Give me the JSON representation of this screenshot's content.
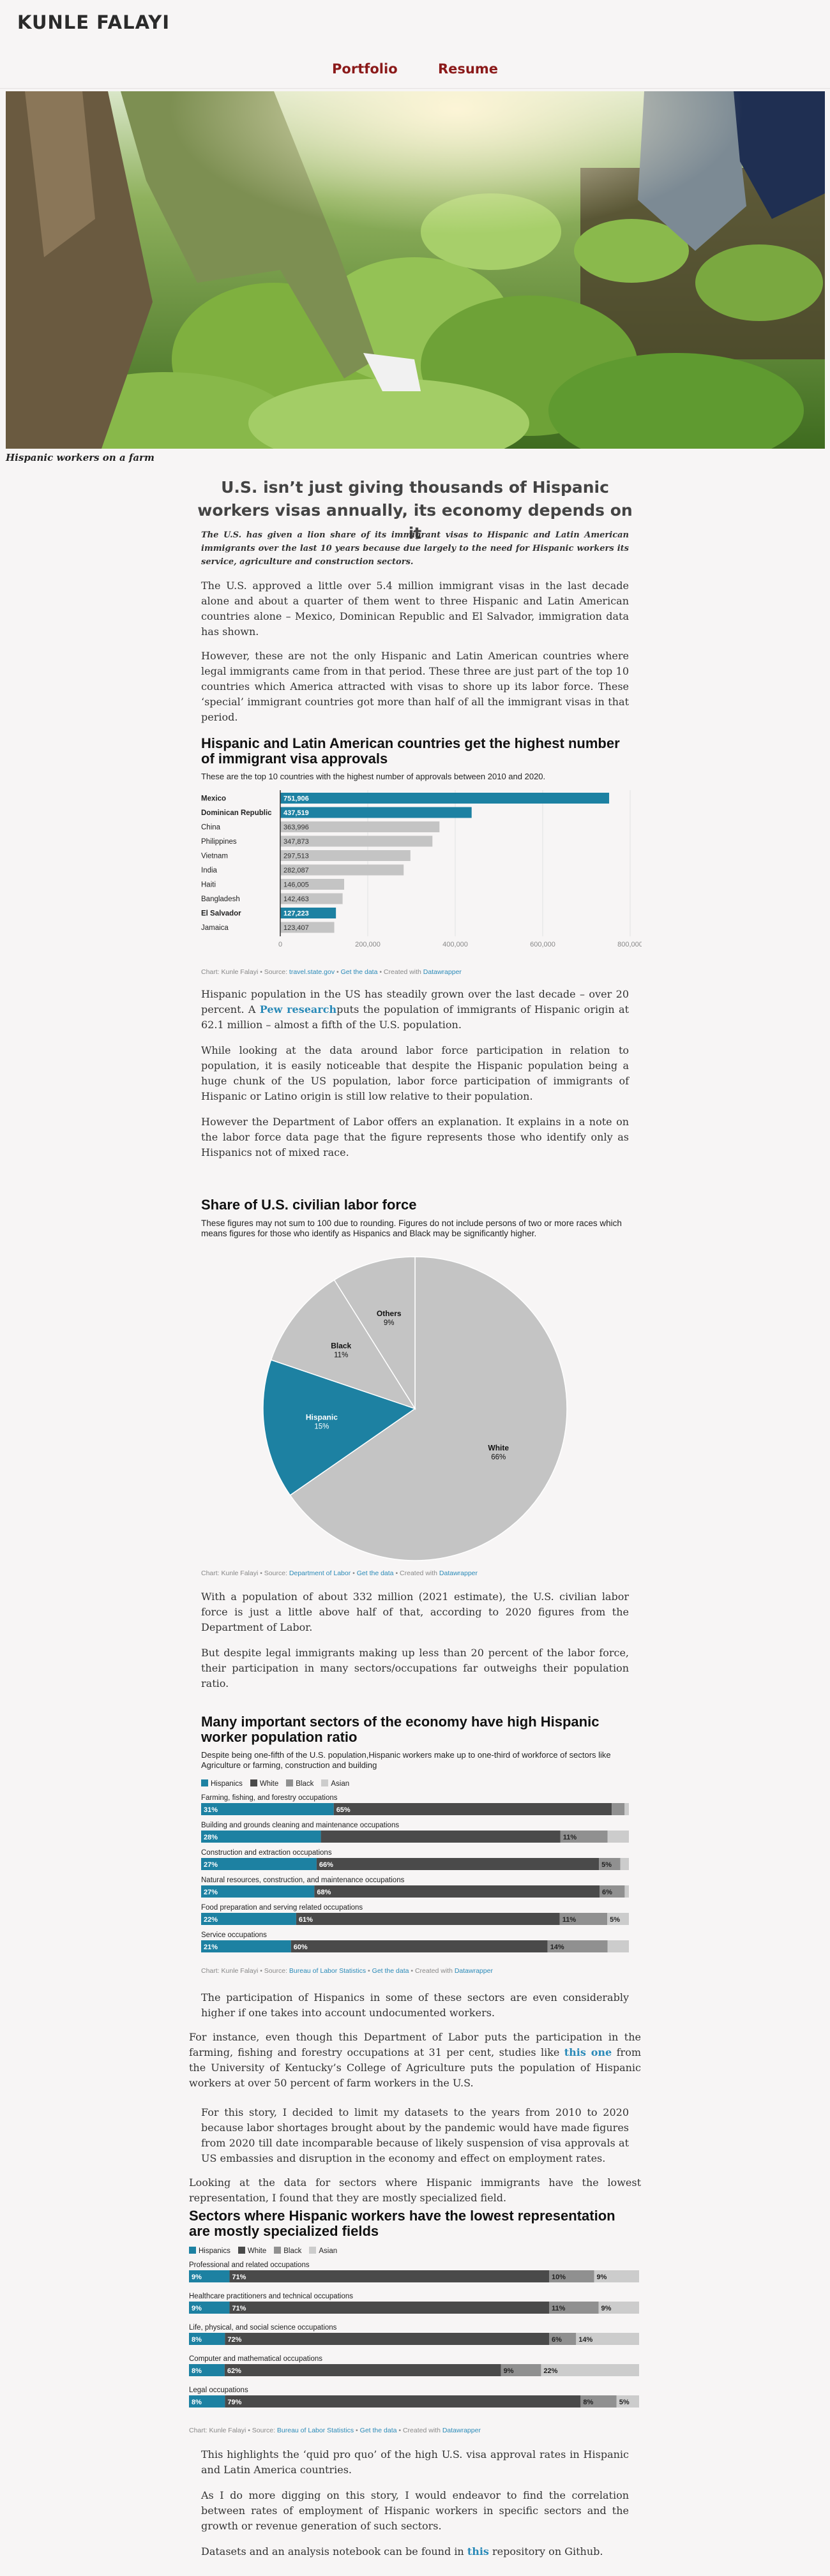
{
  "site": {
    "title": "KUNLE FALAYI",
    "nav": [
      "Portfolio",
      "Resume"
    ]
  },
  "hero": {
    "caption": "Hispanic workers on a farm"
  },
  "article": {
    "headline": "U.S. isn’t just giving thousands of Hispanic workers visas annually, its economy depends on it",
    "lead": "The U.S. has given a lion share of its immigrant visas to Hispanic and Latin American immigrants over the last 10 years because due largely to the need for Hispanic workers its service, agriculture and construction sectors.",
    "p1": "The U.S. approved a little over 5.4 million immigrant visas in the last decade alone and about a quarter of them went to three Hispanic and Latin American countries alone – Mexico, Dominican Republic and El Salvador, immigration data has shown.",
    "p2": "However, these are not the only Hispanic and Latin American countries where legal immigrants came from in that period. These three are just part of the top 10 countries which America attracted with visas to shore up its labor force. These ‘special’ immigrant countries got more than half of all the immigrant visas in that period.",
    "p3a": "Hispanic population in the US has steadily grown over the last decade – over 20 percent. A ",
    "p3link": "Pew research",
    "p3b": "puts the population of immigrants of Hispanic origin at 62.1 million – almost a fifth of the U.S. population.",
    "p4": "While looking at the data around labor force participation in relation to population, it is easily noticeable that despite the Hispanic population being a huge chunk of the US population, labor force participation of immigrants of Hispanic or Latino origin is still low relative to their population.",
    "p5": "However the Department of Labor offers an explanation. It explains in a note on the labor force data page that the figure represents those who identify only as Hispanics not of mixed race.",
    "p6": "With a population of about 332 million (2021 estimate), the U.S. civilian labor force is just a little above half of that, according to 2020 figures from the Department of Labor.",
    "p7": "But despite legal immigrants making up less than 20 percent of the labor force, their participation in many sectors/occupations far outweighs their population ratio.",
    "p8": "The participation of Hispanics in some of these sectors are even considerably higher if one takes into account undocumented workers.",
    "p9a": "For instance, even though this Department of Labor puts the participation in the farming, fishing and forestry occupations at 31 per cent, studies like ",
    "p9link": "this one",
    "p9b": " from the University of Kentucky’s College of Agriculture puts the population of Hispanic workers at over 50 percent of farm workers in the U.S.",
    "p10": "For this story, I decided to limit my datasets to the years from 2010 to 2020 because labor shortages brought about by the pandemic would have made figures from 2020 till date incomparable because of likely suspension of visa approvals at US embassies and disruption in the economy and effect on employment rates.",
    "p11": "Looking at the data for sectors where Hispanic immigrants have the lowest representation, I found that they are mostly specialized field.",
    "p12": "This highlights the ‘quid pro quo’ of the high U.S. visa approval rates in Hispanic and Latin America countries.",
    "p13": "As I do more digging on this story, I would endeavor to find the correlation between rates of employment of Hispanic workers in specific sectors and the growth or revenue generation of such sectors.",
    "p14a": "Datasets and an analysis notebook can be found in ",
    "p14link": "this",
    "p14b": " repository on Github."
  },
  "footer_parts": {
    "chart": "Chart: Kunle Falayi • Source: ",
    "get": "Get the data",
    "created": " • Created with ",
    "dw": "Datawrapper",
    "sep": " • "
  },
  "chart_data": [
    {
      "type": "bar",
      "title": "Hispanic and Latin American countries get the highest number of immigrant visa approvals",
      "subtitle": "These are the top 10 countries with the highest number of approvals between 2010 and 2020.",
      "source": "travel.state.gov",
      "categories": [
        "Mexico",
        "Dominican Republic",
        "China",
        "Philippines",
        "Vietnam",
        "India",
        "Haiti",
        "Bangladesh",
        "El Salvador",
        "Jamaica"
      ],
      "values": [
        751906,
        437519,
        363996,
        347873,
        297513,
        282087,
        146005,
        142463,
        127223,
        123407
      ],
      "labels": [
        "751,906",
        "437,519",
        "363,996",
        "347,873",
        "297,513",
        "282,087",
        "146,005",
        "142,463",
        "127,223",
        "123,407"
      ],
      "highlight": [
        "Mexico",
        "Dominican Republic",
        "El Salvador"
      ],
      "xticks": [
        0,
        200000,
        400000,
        600000,
        800000
      ],
      "xtick_labels": [
        "0",
        "200,000",
        "400,000",
        "600,000",
        "800,000"
      ],
      "xlim": [
        0,
        800000
      ],
      "colors": {
        "highlight": "#1d81a2",
        "other": "#c4c4c4"
      }
    },
    {
      "type": "pie",
      "title": "Share of U.S. civilian labor force",
      "subtitle": "These figures may not sum to 100 due to rounding. Figures do not include persons of two or more races which means figures for those who identify as Hispanics and Black may be significantly higher.",
      "source": "Department of Labor",
      "slices": [
        {
          "label": "White",
          "value": 66,
          "text": "66%",
          "color": "#c4c4c4"
        },
        {
          "label": "Hispanic",
          "value": 15,
          "text": "15%",
          "color": "#1d81a2"
        },
        {
          "label": "Black",
          "value": 11,
          "text": "11%",
          "color": "#c4c4c4"
        },
        {
          "label": "Others",
          "value": 9,
          "text": "9%",
          "color": "#c4c4c4"
        }
      ]
    },
    {
      "type": "bar",
      "stacked": true,
      "title": "Many important sectors of the economy have high Hispanic worker population ratio",
      "subtitle": "Despite being one-fifth of the U.S. population,Hispanic workers make up to one-third of workforce of sectors like Agriculture or farming, construction and building",
      "source": "Bureau of Labor Statistics",
      "legend": [
        "Hispanics",
        "White",
        "Black",
        "Asian"
      ],
      "colors": [
        "#1d81a2",
        "#4a4a4a",
        "#909090",
        "#cccccc"
      ],
      "categories": [
        "Farming, fishing, and forestry occupations",
        "Building and grounds cleaning and maintenance occupations",
        "Construction and extraction occupations",
        "Natural resources, construction, and maintenance occupations",
        "Food preparation and serving related occupations",
        "Service occupations"
      ],
      "series": [
        {
          "name": "Hispanics",
          "values": [
            31,
            28,
            27,
            27,
            22,
            21
          ],
          "labels": [
            "31%",
            "28%",
            "27%",
            "27%",
            "22%",
            "21%"
          ]
        },
        {
          "name": "White",
          "values": [
            65,
            56,
            66,
            68,
            61,
            60
          ],
          "labels": [
            "65%",
            "",
            "66%",
            "68%",
            "61%",
            "60%"
          ]
        },
        {
          "name": "Black",
          "values": [
            3,
            11,
            5,
            6,
            11,
            14
          ],
          "labels": [
            "",
            "11%",
            "5%",
            "6%",
            "11%",
            "14%"
          ]
        },
        {
          "name": "Asian",
          "values": [
            1,
            5,
            2,
            1,
            5,
            5
          ],
          "labels": [
            "",
            "",
            "",
            "",
            "5%",
            ""
          ]
        }
      ]
    },
    {
      "type": "bar",
      "stacked": true,
      "title": "Sectors where Hispanic workers have the lowest representation are mostly specialized fields",
      "subtitle": "",
      "source": "Bureau of Labor Statistics",
      "legend": [
        "Hispanics",
        "White",
        "Black",
        "Asian"
      ],
      "colors": [
        "#1d81a2",
        "#4a4a4a",
        "#909090",
        "#cccccc"
      ],
      "categories": [
        "Professional and related occupations",
        "Healthcare practitioners and technical occupations",
        "Life, physical, and social science occupations",
        "Computer and mathematical occupations",
        "Legal occupations"
      ],
      "series": [
        {
          "name": "Hispanics",
          "values": [
            9,
            9,
            8,
            8,
            8
          ],
          "labels": [
            "9%",
            "9%",
            "8%",
            "8%",
            "8%"
          ]
        },
        {
          "name": "White",
          "values": [
            71,
            71,
            72,
            62,
            79
          ],
          "labels": [
            "71%",
            "71%",
            "72%",
            "62%",
            "79%"
          ]
        },
        {
          "name": "Black",
          "values": [
            10,
            11,
            6,
            9,
            8
          ],
          "labels": [
            "10%",
            "11%",
            "6%",
            "9%",
            "8%"
          ]
        },
        {
          "name": "Asian",
          "values": [
            10,
            9,
            14,
            22,
            5
          ],
          "labels": [
            "9%",
            "9%",
            "14%",
            "22%",
            "5%"
          ]
        }
      ]
    }
  ]
}
